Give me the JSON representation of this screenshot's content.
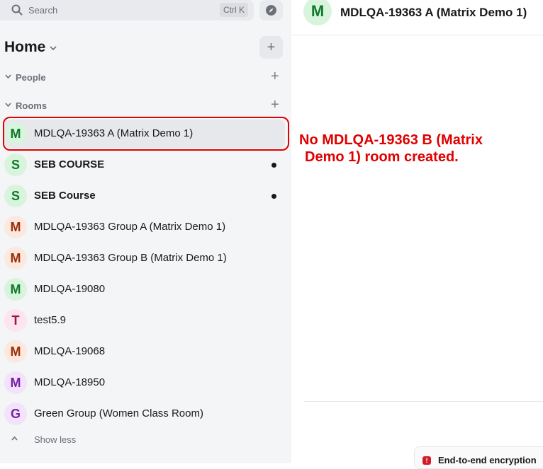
{
  "search": {
    "placeholder": "Search",
    "shortcut": "Ctrl K"
  },
  "home": {
    "title": "Home"
  },
  "sections": {
    "people": "People",
    "rooms": "Rooms"
  },
  "rooms": [
    {
      "initial": "M",
      "name": "MDLQA-19363 A (Matrix Demo 1)",
      "bold": false,
      "unread": false,
      "selected": true,
      "avatar_bg": "#d9f4dc",
      "avatar_fg": "#0d7a2c"
    },
    {
      "initial": "S",
      "name": "SEB COURSE",
      "bold": true,
      "unread": true,
      "selected": false,
      "avatar_bg": "#d9f4dc",
      "avatar_fg": "#0d7a2c"
    },
    {
      "initial": "S",
      "name": "SEB Course",
      "bold": true,
      "unread": true,
      "selected": false,
      "avatar_bg": "#d9f4dc",
      "avatar_fg": "#0d7a2c"
    },
    {
      "initial": "M",
      "name": "MDLQA-19363 Group A (Matrix Demo 1)",
      "bold": false,
      "unread": false,
      "selected": false,
      "avatar_bg": "#fde8df",
      "avatar_fg": "#9c2f06"
    },
    {
      "initial": "M",
      "name": "MDLQA-19363 Group B (Matrix Demo 1)",
      "bold": false,
      "unread": false,
      "selected": false,
      "avatar_bg": "#fde8df",
      "avatar_fg": "#9c2f06"
    },
    {
      "initial": "M",
      "name": "MDLQA-19080",
      "bold": false,
      "unread": false,
      "selected": false,
      "avatar_bg": "#d9f4dc",
      "avatar_fg": "#0d7a2c"
    },
    {
      "initial": "T",
      "name": "test5.9",
      "bold": false,
      "unread": false,
      "selected": false,
      "avatar_bg": "#fde4ee",
      "avatar_fg": "#9c1150"
    },
    {
      "initial": "M",
      "name": "MDLQA-19068",
      "bold": false,
      "unread": false,
      "selected": false,
      "avatar_bg": "#fde8df",
      "avatar_fg": "#9c2f06"
    },
    {
      "initial": "M",
      "name": "MDLQA-18950",
      "bold": false,
      "unread": false,
      "selected": false,
      "avatar_bg": "#f2e3fb",
      "avatar_fg": "#7a1fa8"
    },
    {
      "initial": "G",
      "name": "Green Group (Women Class Room)",
      "bold": false,
      "unread": false,
      "selected": false,
      "avatar_bg": "#f2e3fb",
      "avatar_fg": "#7a1fa8"
    }
  ],
  "show_less": "Show less",
  "main": {
    "avatar_initial": "M",
    "title": "MDLQA-19363 A (Matrix Demo 1)"
  },
  "annotation": {
    "line1": "No MDLQA-19363 B (Matrix",
    "line2": "Demo 1) room created."
  },
  "e2e": {
    "text": "End-to-end encryption"
  },
  "colors": {
    "annotation": "#e00000",
    "sidebar_bg": "#f4f5f7"
  }
}
